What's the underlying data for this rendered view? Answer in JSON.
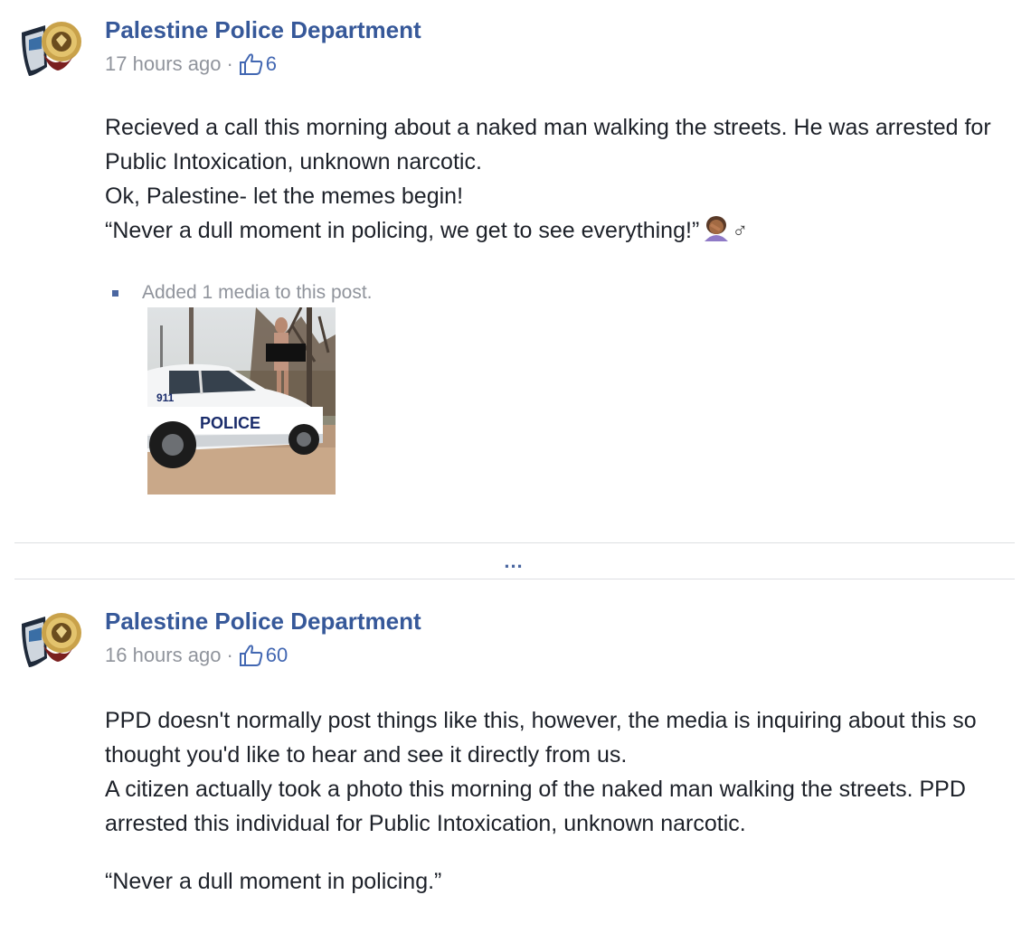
{
  "posts": [
    {
      "author": "Palestine Police Department",
      "time": "17 hours ago",
      "separator": "·",
      "likes": "6",
      "paragraphs": [
        "Recieved a call this morning about a naked man walking the streets. He was arrested for Public Intoxication, unknown narcotic.",
        "Ok, Palestine- let the memes begin!",
        "“Never a dull moment in policing, we get to see everything!”"
      ],
      "emoji": "woman-facepalming-emoji",
      "gender_sign": "♂",
      "media_note": "Added 1 media to this post.",
      "media_caption_text": "POLICE",
      "media_unit_text": "911"
    },
    {
      "author": "Palestine Police Department",
      "time": "16 hours ago",
      "separator": "·",
      "likes": "60",
      "paragraphs": [
        "PPD doesn't normally post things like this, however, the media is inquiring about this so thought you'd like to hear and see it directly from us.",
        "A citizen actually took a photo this morning of the naked man walking the streets. PPD arrested this individual for Public Intoxication, unknown narcotic.",
        "",
        "“Never a dull moment in policing.”"
      ]
    }
  ],
  "more_indicator": "...",
  "colors": {
    "link": "#365899",
    "meta": "#90949c",
    "like": "#4267b2",
    "text": "#1d2129",
    "divider": "#dddfe2"
  },
  "icons": [
    "police-badge-avatar-icon",
    "thumbs-up-icon",
    "bullet-icon"
  ]
}
